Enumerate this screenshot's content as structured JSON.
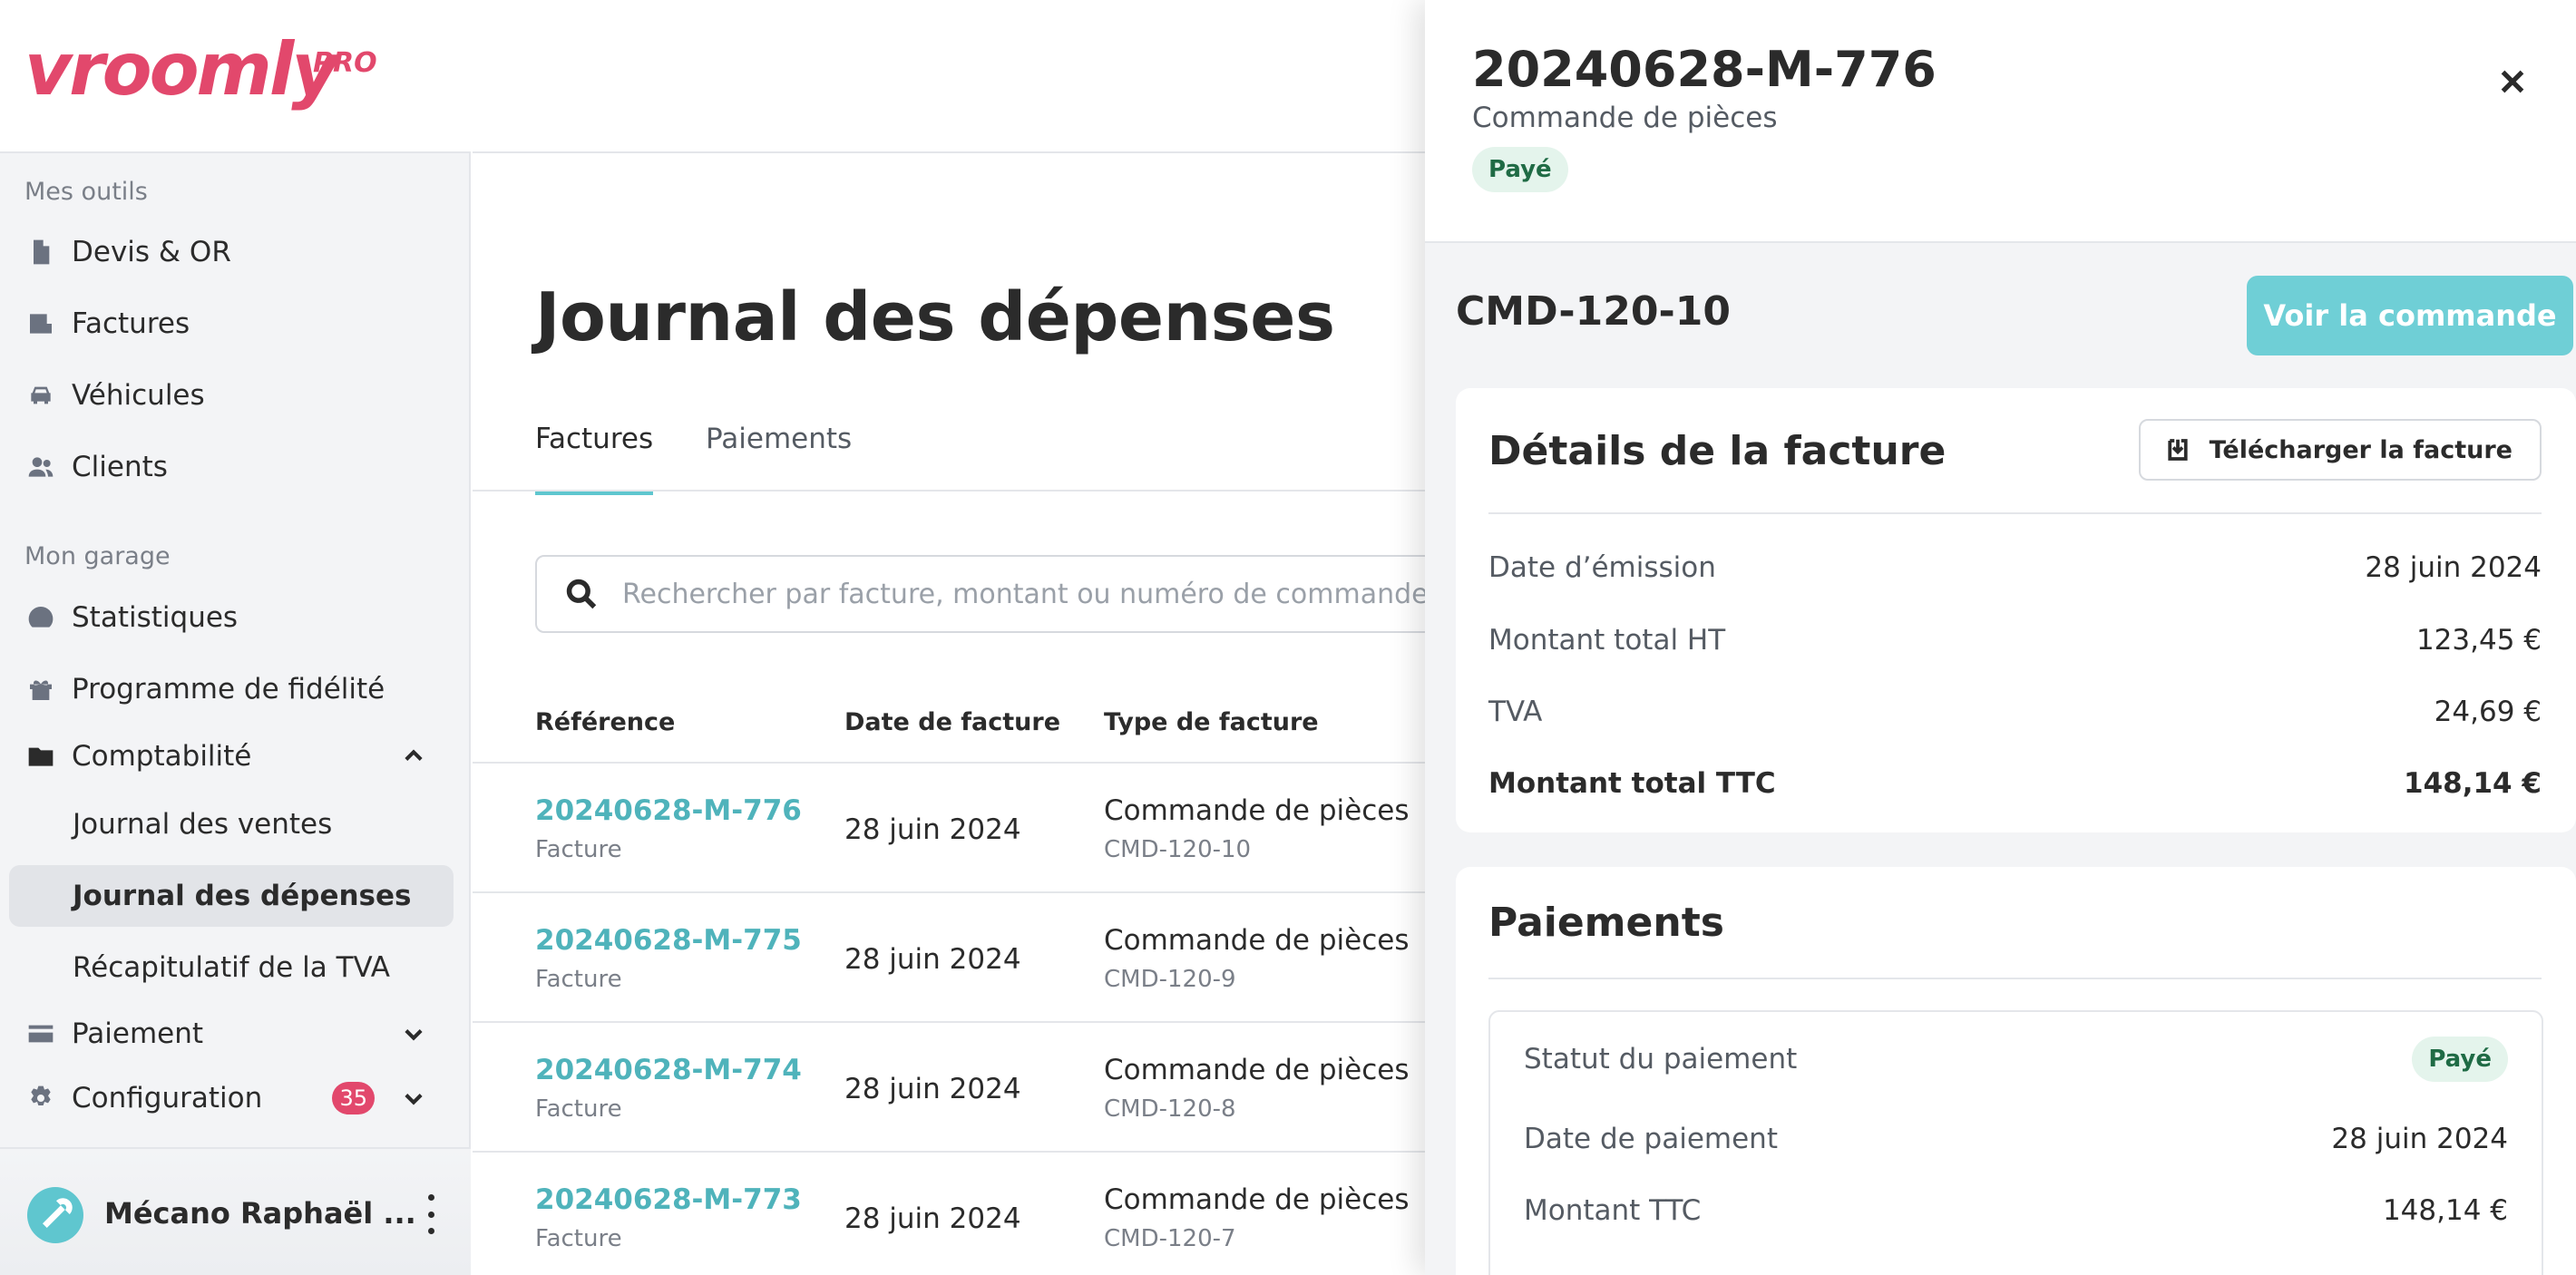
{
  "brand": {
    "name": "vroomly",
    "suffix": "PRO"
  },
  "sidebar": {
    "section_tools": "Mes outils",
    "section_garage": "Mon garage",
    "items": [
      {
        "label": "Devis & OR",
        "icon": "file-icon"
      },
      {
        "label": "Factures",
        "icon": "receipt-icon"
      },
      {
        "label": "Véhicules",
        "icon": "car-icon"
      },
      {
        "label": "Clients",
        "icon": "users-icon"
      },
      {
        "label": "Statistiques",
        "icon": "gauge-icon"
      },
      {
        "label": "Programme de fidélité",
        "icon": "gift-icon"
      },
      {
        "label": "Comptabilité",
        "icon": "folder-icon",
        "expanded": true
      },
      {
        "label": "Journal des ventes"
      },
      {
        "label": "Journal des dépenses",
        "active": true
      },
      {
        "label": "Récapitulatif de la TVA"
      },
      {
        "label": "Paiement",
        "icon": "card-icon"
      },
      {
        "label": "Configuration",
        "icon": "gear-icon",
        "badge": "35"
      }
    ],
    "user": {
      "name": "Mécano Raphaël ..."
    }
  },
  "main": {
    "title": "Journal des dépenses",
    "tabs": [
      {
        "label": "Factures",
        "active": true
      },
      {
        "label": "Paiements",
        "active": false
      }
    ],
    "search": {
      "placeholder": "Rechercher par facture, montant ou numéro de commande"
    },
    "columns": [
      "Référence",
      "Date de facture",
      "Type de facture"
    ],
    "rows": [
      {
        "ref": "20240628-M-776",
        "kind": "Facture",
        "date": "28 juin 2024",
        "type": "Commande de pièces",
        "cmd": "CMD-120-10"
      },
      {
        "ref": "20240628-M-775",
        "kind": "Facture",
        "date": "28 juin 2024",
        "type": "Commande de pièces",
        "cmd": "CMD-120-9"
      },
      {
        "ref": "20240628-M-774",
        "kind": "Facture",
        "date": "28 juin 2024",
        "type": "Commande de pièces",
        "cmd": "CMD-120-8"
      },
      {
        "ref": "20240628-M-773",
        "kind": "Facture",
        "date": "28 juin 2024",
        "type": "Commande de pièces",
        "cmd": "CMD-120-7"
      }
    ]
  },
  "drawer": {
    "title": "20240628-M-776",
    "subtitle": "Commande de pièces",
    "status": "Payé",
    "order_id": "CMD-120-10",
    "view_order_label": "Voir la commande",
    "invoice": {
      "title": "Détails de la facture",
      "download_label": "Télécharger la facture",
      "fields": [
        {
          "label": "Date d’émission",
          "value": "28 juin 2024"
        },
        {
          "label": "Montant total HT",
          "value": "123,45 €"
        },
        {
          "label": "TVA",
          "value": "24,69 €"
        },
        {
          "label": "Montant total TTC",
          "value": "148,14 €"
        }
      ]
    },
    "payments": {
      "title": "Paiements",
      "status_label": "Statut du paiement",
      "status_value": "Payé",
      "date_label": "Date de paiement",
      "date_value": "28 juin 2024",
      "amount_label": "Montant TTC",
      "amount_value": "148,14 €"
    }
  },
  "colors": {
    "brand": "#e2486c",
    "accent": "#5fc6cf",
    "link": "#4fb3bb",
    "success_bg": "#e4f4ec",
    "success_text": "#1f6b45"
  }
}
